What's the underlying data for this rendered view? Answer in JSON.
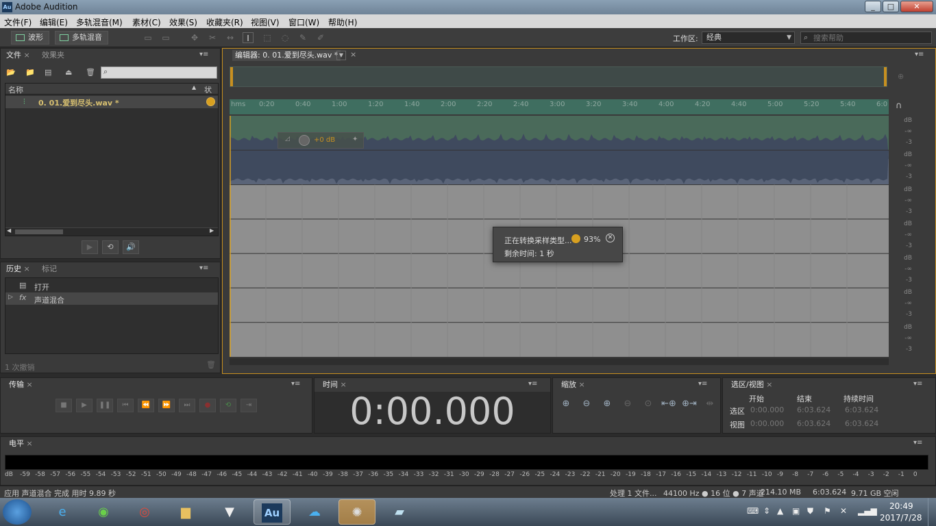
{
  "window": {
    "title": "Adobe Audition",
    "app_icon": "Au"
  },
  "menu": [
    "文件(F)",
    "编辑(E)",
    "多轨混音(M)",
    "素材(C)",
    "效果(S)",
    "收藏夹(R)",
    "视图(V)",
    "窗口(W)",
    "帮助(H)"
  ],
  "toolbar": {
    "waveform_label": "波形",
    "multitrack_label": "多轨混音",
    "workspace_label": "工作区:",
    "workspace_value": "经典",
    "search_placeholder": "搜索帮助"
  },
  "files_panel": {
    "tab_files": "文件",
    "tab_effects": "效果夹",
    "col_name": "名称",
    "col_status": "状态",
    "items": [
      {
        "name": "0. 01.爱到尽头.wav *"
      }
    ]
  },
  "history_panel": {
    "tab_history": "历史",
    "tab_markers": "标记",
    "items": [
      {
        "label": "打开"
      },
      {
        "label": "声道混合"
      }
    ],
    "undo_count": "1 次撤销"
  },
  "editor": {
    "tab_title": "编辑器: 0. 01.爱到尽头.wav *",
    "clip_gain": "+0 dB",
    "progress_text": "正在转换采样类型...",
    "progress_percent": "93%",
    "progress_value": 93,
    "remaining_time": "剩余时间: 1 秒"
  },
  "chart_data": {
    "type": "line",
    "x_unit": "time",
    "x_ticks": [
      "hms",
      "0:20",
      "0:40",
      "1:00",
      "1:20",
      "1:40",
      "2:00",
      "2:20",
      "2:40",
      "3:00",
      "3:20",
      "3:40",
      "4:00",
      "4:20",
      "4:40",
      "5:00",
      "5:20",
      "5:40",
      "6:0"
    ],
    "duration": "6:03.624",
    "channel_db_labels": [
      "dB",
      "-∞",
      "-3"
    ],
    "channel_count": 7
  },
  "transport": {
    "tab": "传输"
  },
  "time": {
    "tab": "时间",
    "display": "0:00.000"
  },
  "zoom": {
    "tab": "缩放"
  },
  "selection": {
    "tab": "选区/视图",
    "headers": [
      "开始",
      "结束",
      "持续时间"
    ],
    "rows": [
      {
        "label": "选区",
        "start": "0:00.000",
        "end": "6:03.624",
        "duration": "6:03.624"
      },
      {
        "label": "视图",
        "start": "0:00.000",
        "end": "6:03.624",
        "duration": "6:03.624"
      }
    ]
  },
  "levels": {
    "tab": "电平",
    "scale": [
      "dB",
      "-59",
      "-58",
      "-57",
      "-56",
      "-55",
      "-54",
      "-53",
      "-52",
      "-51",
      "-50",
      "-49",
      "-48",
      "-47",
      "-46",
      "-45",
      "-44",
      "-43",
      "-42",
      "-41",
      "-40",
      "-39",
      "-38",
      "-37",
      "-36",
      "-35",
      "-34",
      "-33",
      "-32",
      "-31",
      "-30",
      "-29",
      "-28",
      "-27",
      "-26",
      "-25",
      "-24",
      "-23",
      "-22",
      "-21",
      "-20",
      "-19",
      "-18",
      "-17",
      "-16",
      "-15",
      "-14",
      "-13",
      "-12",
      "-11",
      "-10",
      "-9",
      "-8",
      "-7",
      "-6",
      "-5",
      "-4",
      "-3",
      "-2",
      "-1",
      "0"
    ]
  },
  "status": {
    "message": "应用 声道混合 完成 用时 9.89 秒",
    "processing": "处理 1 文件...",
    "format": "44100 Hz ● 16 位 ● 7 声道",
    "size": "214.10 MB",
    "duration": "6:03.624",
    "free": "9.71 GB 空闲"
  },
  "taskbar": {
    "clock_time": "20:49",
    "clock_date": "2017/7/28",
    "au_label": "Au"
  },
  "colors": {
    "accent_orange": "#d8a020",
    "waveform": "#3f4a5e",
    "track_green": "#4a6a5a",
    "timeline_bg": "#3f6e60"
  }
}
